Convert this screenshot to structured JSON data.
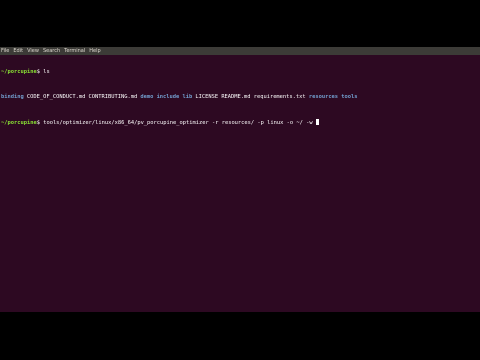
{
  "window": {
    "background": "#2d0922"
  },
  "menubar": {
    "items": [
      "File",
      "Edit",
      "View",
      "Search",
      "Terminal",
      "Help"
    ]
  },
  "terminal": {
    "prompt_user": "~/porcupine",
    "prompt_symbol": "$",
    "cmd1": "ls",
    "ls_output": [
      {
        "name": "binding",
        "type": "dir"
      },
      {
        "name": "CODE_OF_CONDUCT.md",
        "type": "file"
      },
      {
        "name": "CONTRIBUTING.md",
        "type": "file"
      },
      {
        "name": "demo",
        "type": "dir"
      },
      {
        "name": "include",
        "type": "dir"
      },
      {
        "name": "lib",
        "type": "dir"
      },
      {
        "name": "LICENSE",
        "type": "file"
      },
      {
        "name": "README.md",
        "type": "file"
      },
      {
        "name": "requirements.txt",
        "type": "file"
      },
      {
        "name": "resources",
        "type": "dir"
      },
      {
        "name": "tools",
        "type": "dir"
      }
    ],
    "cmd2": "tools/optimizer/linux/x86_64/pv_porcupine_optimizer -r resources/ -p linux -o ~/ -w "
  },
  "colors": {
    "prompt": "#8ae234",
    "directory": "#729fcf",
    "text": "#ffffff"
  }
}
